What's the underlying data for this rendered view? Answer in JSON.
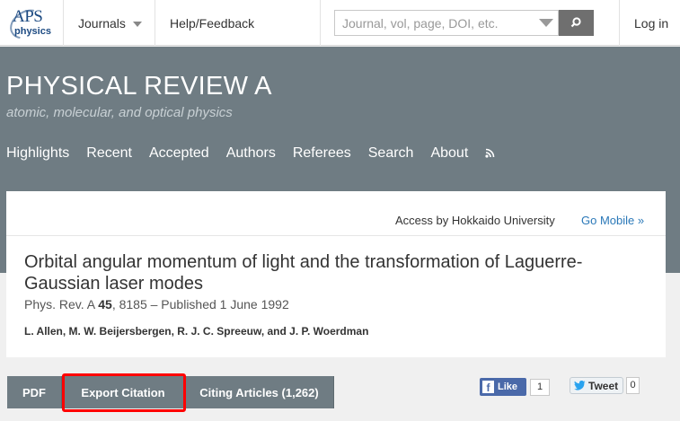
{
  "topbar": {
    "logo_text": "APS",
    "logo_subtext": "physics",
    "journals_label": "Journals",
    "help_label": "Help/Feedback",
    "search_placeholder": "Journal, vol, page, DOI, etc.",
    "login_label": "Log in"
  },
  "header": {
    "title": "PHYSICAL REVIEW A",
    "subtitle": "atomic, molecular, and optical physics",
    "nav": [
      "Highlights",
      "Recent",
      "Accepted",
      "Authors",
      "Referees",
      "Search",
      "About"
    ]
  },
  "access": {
    "text": "Access by Hokkaido University",
    "mobile_link": "Go Mobile »"
  },
  "article": {
    "title": "Orbital angular momentum of light and the transformation of Laguerre-Gaussian laser modes",
    "journal": "Phys. Rev. A",
    "volume": "45",
    "meta_rest": ", 8185 – Published 1 June 1992",
    "authors": "L. Allen, M. W. Beijersbergen, R. J. C. Spreeuw, and J. P. Woerdman"
  },
  "actions": {
    "pdf": "PDF",
    "export": "Export Citation",
    "citing": "Citing Articles (1,262)"
  },
  "social": {
    "like_label": "Like",
    "like_count": "1",
    "tweet_label": "Tweet",
    "tweet_count": "0"
  },
  "colors": {
    "header_bg": "#6f7c83",
    "link": "#2a78b8",
    "highlight": "#ff0000"
  }
}
